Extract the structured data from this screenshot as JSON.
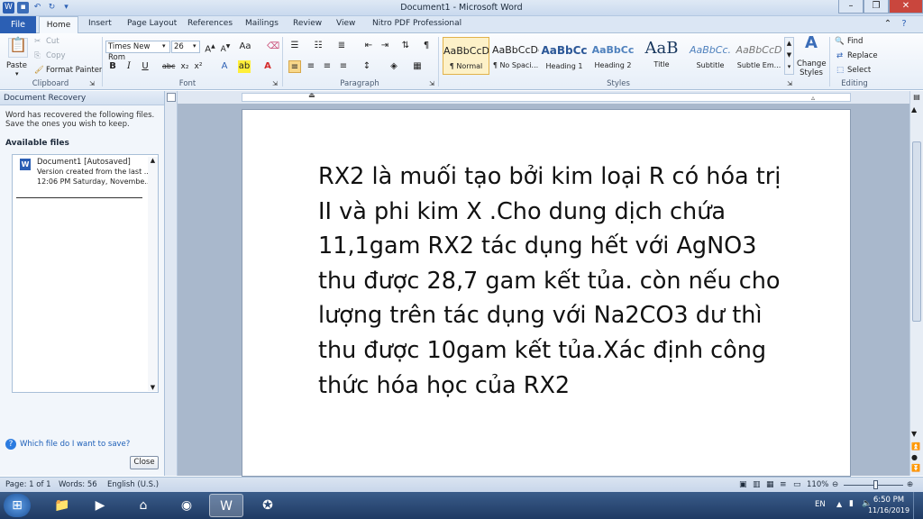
{
  "window": {
    "title": "Document1  -  Microsoft Word"
  },
  "tabs": [
    "File",
    "Home",
    "Insert",
    "Page Layout",
    "References",
    "Mailings",
    "Review",
    "View",
    "Nitro PDF Professional"
  ],
  "clipboard": {
    "paste": "Paste",
    "cut": "Cut",
    "copy": "Copy",
    "format_painter": "Format Painter",
    "label": "Clipboard"
  },
  "font": {
    "name": "Times New Rom",
    "size": "26",
    "label": "Font"
  },
  "paragraph": {
    "label": "Paragraph"
  },
  "styles": {
    "label": "Styles",
    "items": [
      {
        "preview": "AaBbCcDc",
        "name": "¶ Normal"
      },
      {
        "preview": "AaBbCcDc",
        "name": "¶ No Spaci..."
      },
      {
        "preview": "AaBbCc",
        "name": "Heading 1"
      },
      {
        "preview": "AaBbCc",
        "name": "Heading 2"
      },
      {
        "preview": "AaB",
        "name": "Title"
      },
      {
        "preview": "AaBbCc.",
        "name": "Subtitle"
      },
      {
        "preview": "AaBbCcD",
        "name": "Subtle Em..."
      }
    ],
    "change_styles": "Change Styles"
  },
  "editing": {
    "find": "Find",
    "replace": "Replace",
    "select": "Select",
    "label": "Editing"
  },
  "recovery": {
    "title": "Document Recovery",
    "message": "Word has recovered the following files.  Save the ones you wish to keep.",
    "available": "Available files",
    "file_name": "Document1  [Autosaved]",
    "file_line2": "Version created from the last ...",
    "file_line3": "12:06 PM Saturday, Novembe...",
    "help_link": "Which file do I want to save?",
    "close": "Close"
  },
  "document": {
    "lines": [
      "RX2 là muối tạo bởi kim loại R có hóa trị",
      "II và phi kim X .Cho dung dịch chứa",
      "11,1gam RX2 tác dụng hết với AgNO3",
      "thu được 28,7 gam kết tủa. còn nếu cho",
      "lượng trên tác dụng với Na2CO3 dư thì",
      "thu được 10gam kết tủa.Xác định công",
      "thức hóa học của RX2"
    ]
  },
  "status": {
    "page": "Page: 1 of 1",
    "words": "Words: 56",
    "language": "English (U.S.)",
    "zoom": "110%"
  },
  "taskbar": {
    "lang": "EN",
    "time": "6:50 PM",
    "date": "11/16/2019"
  },
  "colors": {
    "accent": "#2b5fb4",
    "ribbon": "#e6eef8",
    "taskbar": "#1f3a63"
  }
}
